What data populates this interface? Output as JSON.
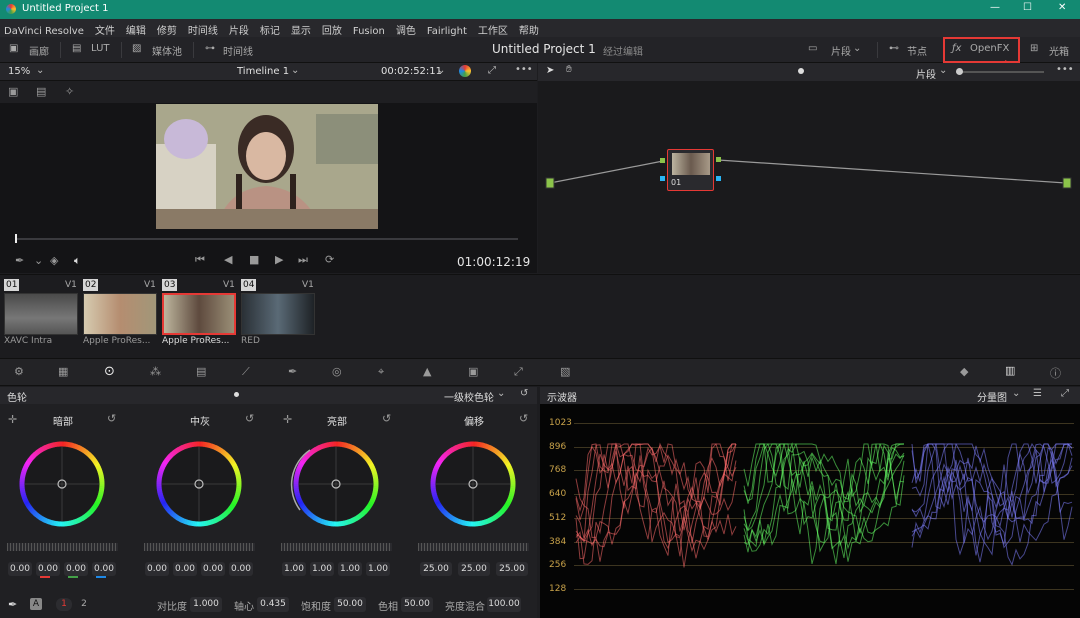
{
  "titlebar": {
    "title": "Untitled Project 1",
    "minimize": "—",
    "maximize": "☐",
    "close": "✕"
  },
  "menu": [
    "DaVinci Resolve",
    "文件",
    "编辑",
    "修剪",
    "时间线",
    "片段",
    "标记",
    "显示",
    "回放",
    "Fusion",
    "调色",
    "Fairlight",
    "工作区",
    "帮助"
  ],
  "toolbar": {
    "gallery": "画廊",
    "lut": "LUT",
    "media_pool": "媒体池",
    "timeline": "时间线",
    "project_title": "Untitled Project 1",
    "status": "经过编辑",
    "clips": "片段",
    "nodes": "节点",
    "openfx": "OpenFX",
    "lightbox": "光箱"
  },
  "viewer": {
    "zoom": "15%",
    "timeline_name": "Timeline 1",
    "duration": "00:02:52:11",
    "timecode": "01:00:12:19"
  },
  "node_editor": {
    "mode": "片段",
    "node_label": "01"
  },
  "clips": [
    {
      "num": "01",
      "track": "V1",
      "name": "XAVC Intra"
    },
    {
      "num": "02",
      "track": "V1",
      "name": "Apple ProRes..."
    },
    {
      "num": "03",
      "track": "V1",
      "name": "Apple ProRes..."
    },
    {
      "num": "04",
      "track": "V1",
      "name": "RED"
    }
  ],
  "wheels": {
    "panel_title": "色轮",
    "mode": "一级校色轮",
    "items": [
      {
        "label": "暗部",
        "values": [
          "0.00",
          "0.00",
          "0.00",
          "0.00"
        ]
      },
      {
        "label": "中灰",
        "values": [
          "0.00",
          "0.00",
          "0.00",
          "0.00"
        ]
      },
      {
        "label": "亮部",
        "values": [
          "1.00",
          "1.00",
          "1.00",
          "1.00"
        ]
      },
      {
        "label": "偏移",
        "values": [
          "25.00",
          "25.00",
          "25.00"
        ]
      }
    ],
    "bottom": {
      "page1": "1",
      "page2": "2",
      "contrast_label": "对比度",
      "contrast": "1.000",
      "pivot_label": "轴心",
      "pivot": "0.435",
      "sat_label": "饱和度",
      "sat": "50.00",
      "hue_label": "色相",
      "hue": "50.00",
      "lummix_label": "亮度混合",
      "lummix": "100.00"
    }
  },
  "scope": {
    "title": "示波器",
    "mode": "分量图",
    "ticks": [
      "1023",
      "896",
      "768",
      "640",
      "512",
      "384",
      "256",
      "128"
    ]
  },
  "colors": {
    "accent": "#138a72",
    "highlight": "#e53935"
  }
}
